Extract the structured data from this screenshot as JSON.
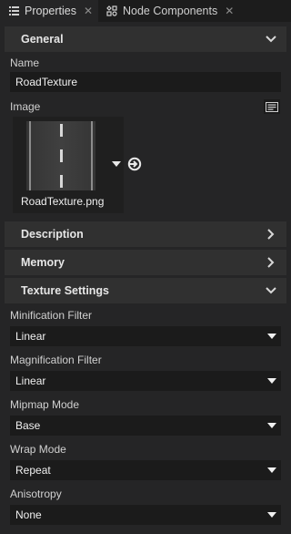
{
  "tabs": [
    {
      "label": "Properties",
      "icon": "list-icon",
      "active": true
    },
    {
      "label": "Node Components",
      "icon": "components-icon",
      "active": false
    }
  ],
  "sections": {
    "general": "General",
    "description": "Description",
    "memory": "Memory",
    "texture_settings": "Texture Settings"
  },
  "name": {
    "label": "Name",
    "value": "RoadTexture"
  },
  "image": {
    "label": "Image",
    "filename": "RoadTexture.png",
    "browse_icon": "image-browser-icon"
  },
  "minification_filter": {
    "label": "Minification Filter",
    "value": "Linear"
  },
  "magnification_filter": {
    "label": "Magnification Filter",
    "value": "Linear"
  },
  "mipmap_mode": {
    "label": "Mipmap Mode",
    "value": "Base"
  },
  "wrap_mode": {
    "label": "Wrap Mode",
    "value": "Repeat"
  },
  "anisotropy": {
    "label": "Anisotropy",
    "value": "None"
  }
}
